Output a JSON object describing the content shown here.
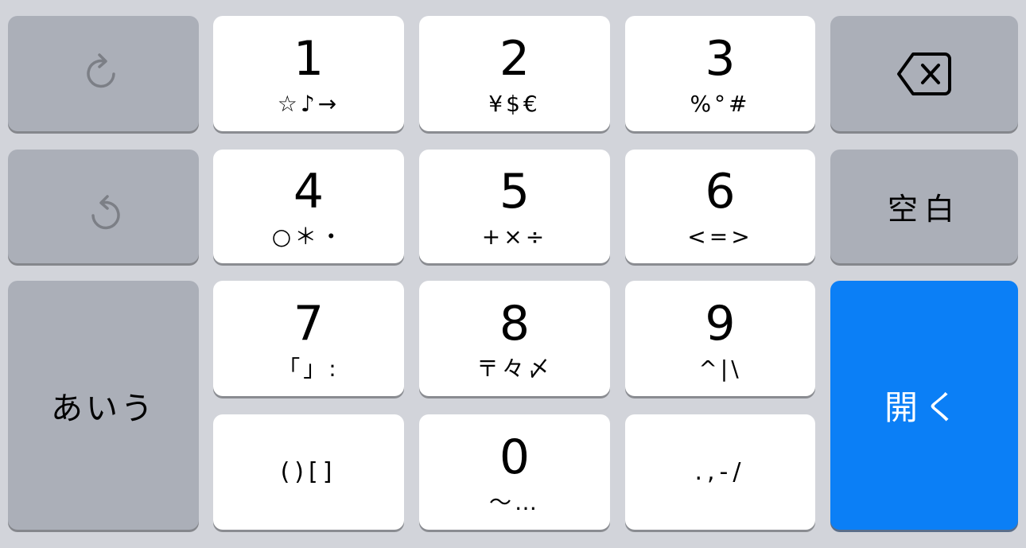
{
  "keyboard": {
    "left_column": {
      "redo_icon": "redo-arrow",
      "undo_icon": "undo-arrow",
      "mode_label": "あいう"
    },
    "right_column": {
      "backspace_icon": "backspace-x",
      "space_label": "空白",
      "return_label": "開く",
      "return_color": "#0b7ff6"
    },
    "keys": [
      {
        "num": "1",
        "sub": "☆♪→"
      },
      {
        "num": "2",
        "sub": "¥$€"
      },
      {
        "num": "3",
        "sub": "%°#"
      },
      {
        "num": "4",
        "sub": "○＊・"
      },
      {
        "num": "5",
        "sub": "+×÷"
      },
      {
        "num": "6",
        "sub": "<=>"
      },
      {
        "num": "7",
        "sub": "「」:"
      },
      {
        "num": "8",
        "sub": "〒々〆"
      },
      {
        "num": "9",
        "sub": "^|\\"
      },
      {
        "num": "",
        "sub": "()[]"
      },
      {
        "num": "0",
        "sub": "〜…"
      },
      {
        "num": "",
        "sub": ".,-/"
      }
    ]
  }
}
